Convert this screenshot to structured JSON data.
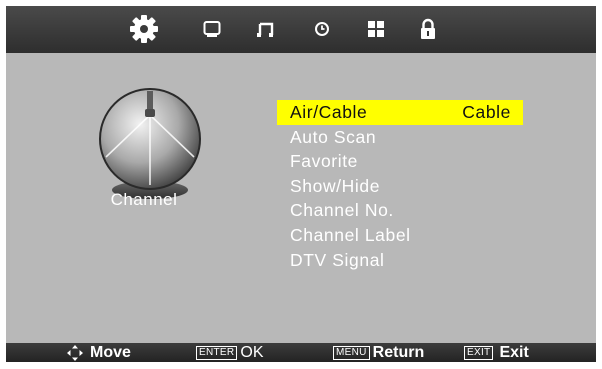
{
  "header": {
    "tabs": [
      {
        "icon": "gear-icon",
        "selected": true
      },
      {
        "icon": "tv-icon"
      },
      {
        "icon": "music-note-icon"
      },
      {
        "icon": "clock-icon"
      },
      {
        "icon": "grid-icon"
      },
      {
        "icon": "lock-icon"
      }
    ]
  },
  "sidebar": {
    "icon": "satellite-dish-icon",
    "label": "Channel"
  },
  "menu": {
    "items": [
      {
        "label": "Air/Cable",
        "value": "Cable",
        "selected": true
      },
      {
        "label": "Auto Scan"
      },
      {
        "label": "Favorite"
      },
      {
        "label": "Show/Hide"
      },
      {
        "label": "Channel No."
      },
      {
        "label": "Channel Label"
      },
      {
        "label": "DTV Signal"
      }
    ]
  },
  "footer": {
    "move_label": "Move",
    "enter_key": "ENTER",
    "ok_label": "OK",
    "menu_key": "MENU",
    "return_label": "Return",
    "exit_key": "EXIT",
    "exit_label": "Exit"
  },
  "colors": {
    "highlight": "#ffff00",
    "background": "#b8b8b8",
    "bar": "#333333"
  }
}
